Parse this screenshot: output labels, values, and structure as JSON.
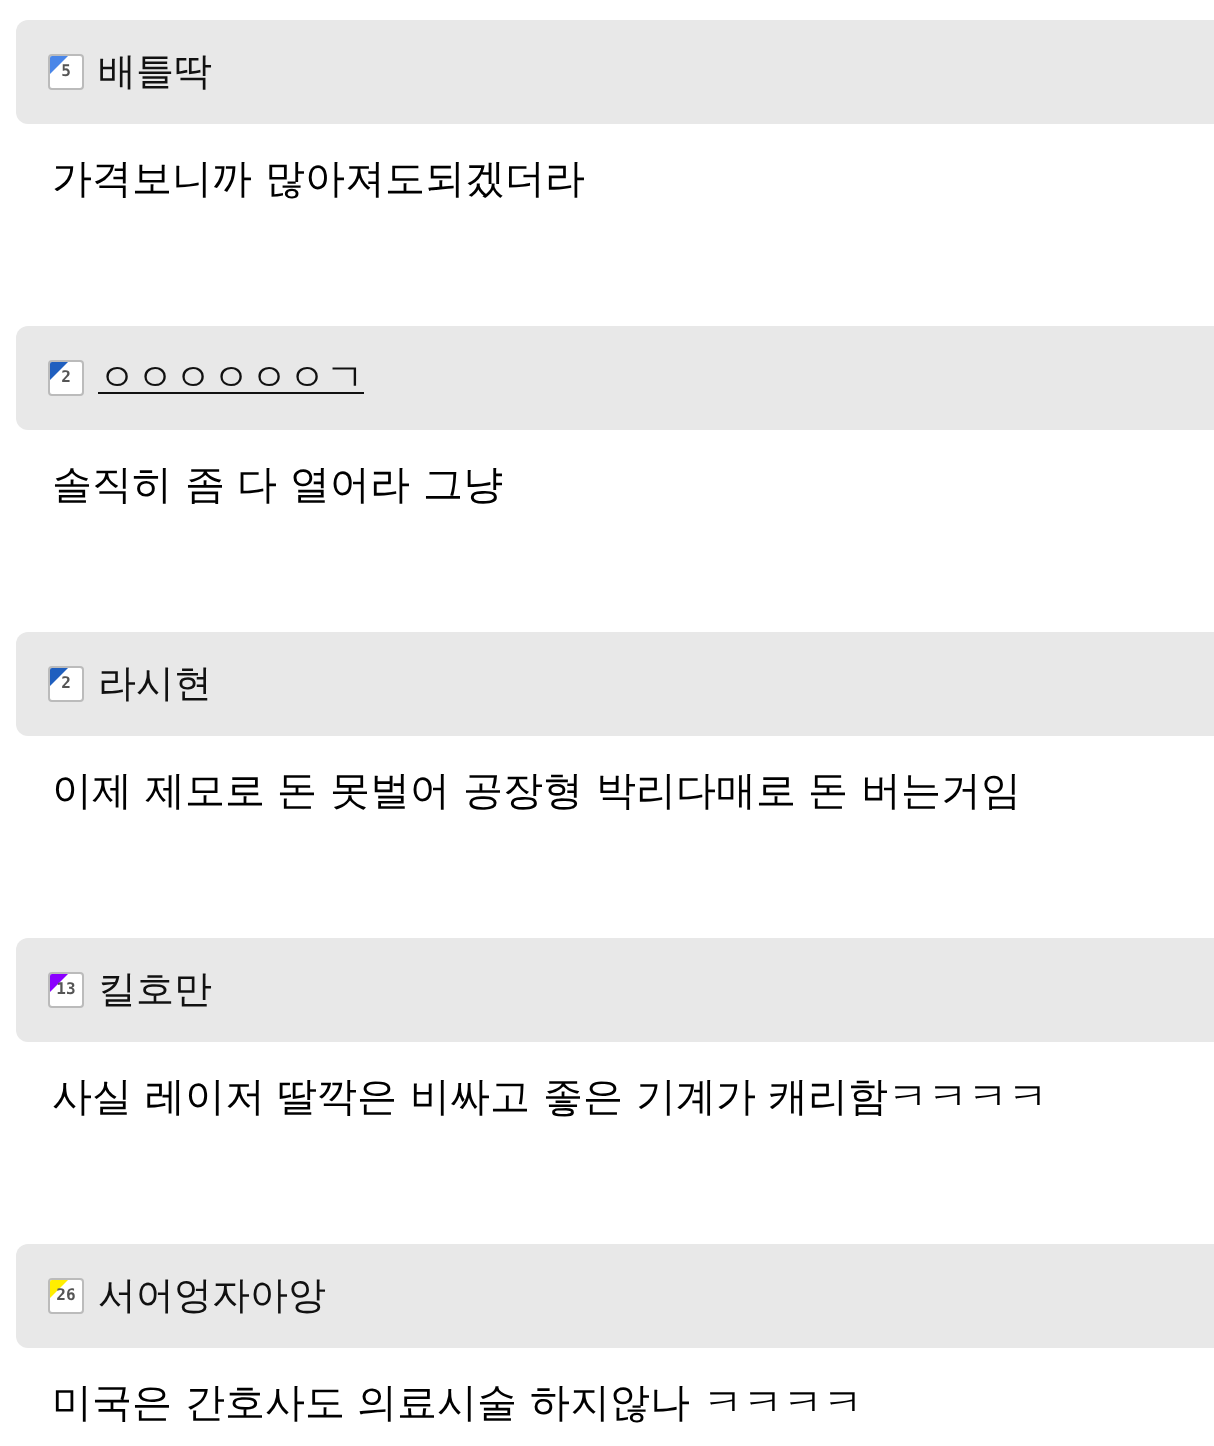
{
  "comments": [
    {
      "level": "5",
      "color": "#4a86e8",
      "author": "배틀딱",
      "underlined": false,
      "text": "가격보니까 많아져도되겠더라"
    },
    {
      "level": "2",
      "color": "#1f5fbf",
      "author": "ㅇㅇㅇㅇㅇㅇㄱ",
      "underlined": true,
      "text": "솔직히 좀 다 열어라 그냥"
    },
    {
      "level": "2",
      "color": "#1f5fbf",
      "author": "라시현",
      "underlined": false,
      "text": "이제 제모로 돈 못벌어 공장형 박리다매로 돈 버는거임"
    },
    {
      "level": "13",
      "color": "#8a00ff",
      "author": "킬호만",
      "underlined": false,
      "text": "사실 레이저 딸깍은 비싸고 좋은 기계가 캐리함ㅋㅋㅋㅋ"
    },
    {
      "level": "26",
      "color": "#ffee00",
      "author": "서어엉자아앙",
      "underlined": false,
      "text": "미국은 간호사도 의료시술 하지않나 ㅋㅋㅋㅋ"
    }
  ]
}
